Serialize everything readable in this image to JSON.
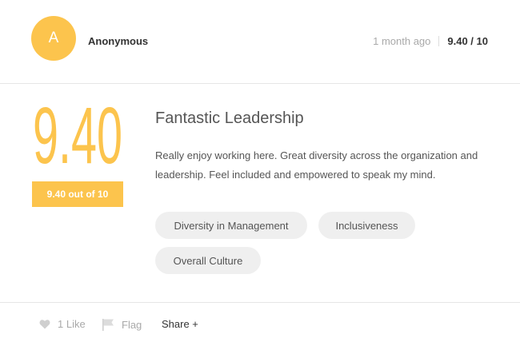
{
  "review": {
    "author_initial": "A",
    "author_name": "Anonymous",
    "time_ago": "1 month ago",
    "score_summary": "9.40 / 10",
    "big_score": "9.40",
    "score_badge": "9.40 out of 10",
    "title": "Fantastic Leadership",
    "body": "Really enjoy working here. Great diversity across the organization and leadership. Feel included and empowered to speak my mind.",
    "tags": [
      "Diversity in Management",
      "Inclusiveness",
      "Overall Culture"
    ]
  },
  "actions": {
    "like_label": "1 Like",
    "flag_label": "Flag",
    "share_label": "Share +"
  },
  "colors": {
    "accent": "#fcc44d",
    "muted_text": "#a9a9a9",
    "tag_bg": "#efefef"
  },
  "icons": {
    "like": "heart-icon",
    "flag": "flag-icon"
  }
}
